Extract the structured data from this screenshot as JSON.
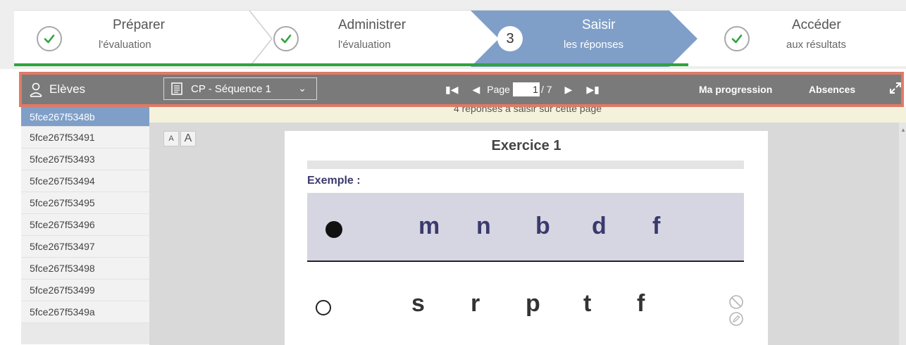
{
  "steps": [
    {
      "line1": "Préparer",
      "line2": "l'évaluation",
      "state": "done"
    },
    {
      "line1": "Administrer",
      "line2": "l'évaluation",
      "state": "done"
    },
    {
      "number": "3",
      "line1": "Saisir",
      "line2": "les réponses",
      "state": "active"
    },
    {
      "line1": "Accéder",
      "line2": "aux résultats",
      "state": "done"
    }
  ],
  "toolbar": {
    "students_label": "Elèves",
    "sequence": "CP - Séquence 1",
    "page_label": "Page",
    "page_value": "1",
    "page_total": "/ 7",
    "progression": "Ma progression",
    "absences": "Absences"
  },
  "students": {
    "active": "5fce267f5348b",
    "items": [
      "5fce267f53491",
      "5fce267f53493",
      "5fce267f53494",
      "5fce267f53495",
      "5fce267f53496",
      "5fce267f53497",
      "5fce267f53498",
      "5fce267f53499",
      "5fce267f5349a"
    ]
  },
  "content": {
    "banner": "4 réponses à saisir sur cette page",
    "font_small": "A",
    "font_big": "A",
    "exercise_title": "Exercice 1",
    "example_label": "Exemple :",
    "example_letters": [
      "m",
      "n",
      "b",
      "d",
      "f"
    ],
    "question_letters": [
      "s",
      "r",
      "p",
      "t",
      "f"
    ]
  },
  "colors": {
    "accent_blue": "#7f9fc8",
    "toolbar_gray": "#7a7a7a",
    "progress_green": "#2ea43c",
    "highlight": "#e07a66",
    "letter_blue": "#3a3a6e"
  },
  "icons": {
    "done_step": "check-icon",
    "students": "student-icon",
    "sequence": "document-icon",
    "expand": "expand-icon",
    "not_answered": "blocked-icon",
    "edit": "edit-icon"
  }
}
